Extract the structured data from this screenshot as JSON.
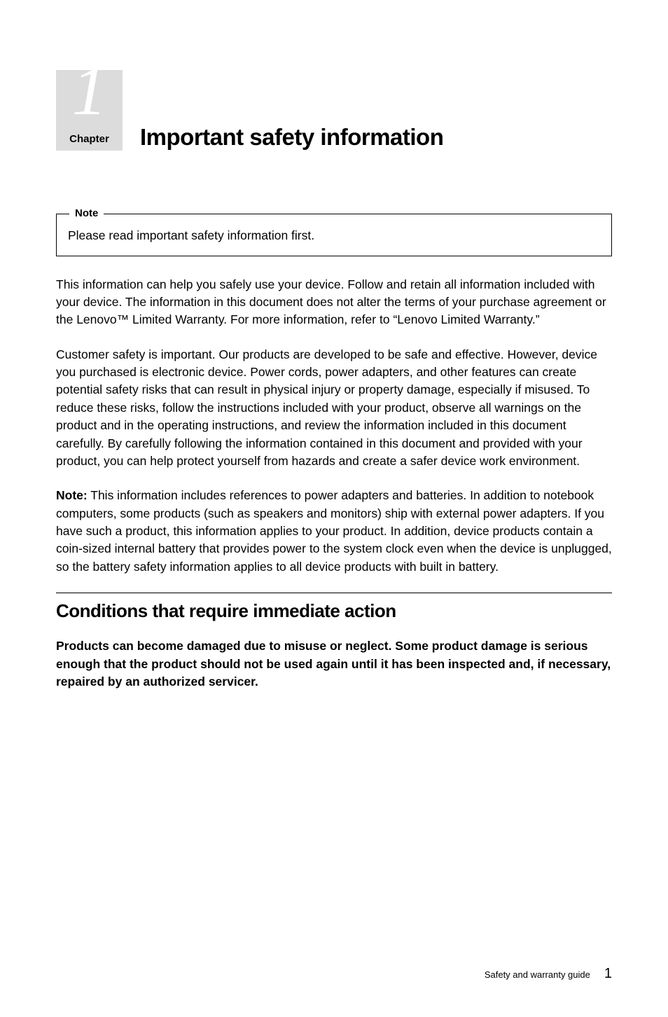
{
  "chapter": {
    "number": "1",
    "label": "Chapter",
    "title": "Important safety information"
  },
  "note_box": {
    "label": "Note",
    "content": "Please read important safety information first."
  },
  "paragraphs": {
    "p1": "This information can help you safely use your device. Follow and retain all information included with your device. The information in this document does not alter the terms of your purchase agreement or the Lenovo™ Limited Warranty. For more information, refer to “Lenovo Limited Warranty.”",
    "p2": "Customer safety is important. Our products are developed to be safe and effective. However, device you purchased is electronic device. Power cords, power adapters, and other features can create potential safety risks that can result in physical injury or property damage, especially if misused. To reduce these risks, follow the instructions included with your product, observe all warnings on the product and in the operating instructions, and review the information included in this document carefully. By carefully following the information contained in this document and provided with your product, you can help protect yourself from hazards and create a safer device work environment.",
    "p3_prefix": "Note:",
    "p3": " This information includes references to power adapters and batteries. In addition to notebook computers, some products (such as speakers and monitors) ship with external power adapters. If you have such a product, this information applies to your product. In addition, device products contain a coin-sized internal battery that provides power to the system clock even when the device is unplugged, so the battery safety information applies to all device products with built in battery."
  },
  "section": {
    "heading": "Conditions that require immediate action",
    "p1": "Products can become damaged due to misuse or neglect. Some product damage is serious enough that the product should not be used again until it has been inspected and, if necessary, repaired by an authorized servicer."
  },
  "footer": {
    "text": "Safety and warranty guide",
    "page": "1"
  }
}
